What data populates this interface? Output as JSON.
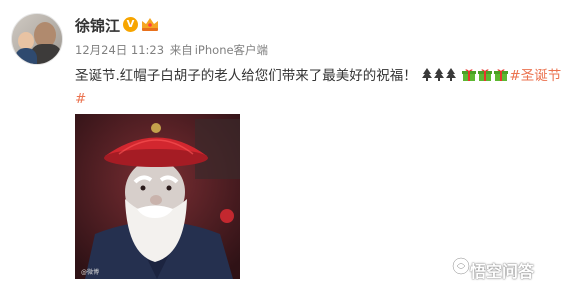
{
  "post": {
    "author": "徐锦江",
    "verified_badge": "V",
    "date": "12月24日 11:23",
    "source_prefix": "来自",
    "source": "iPhone客户端",
    "text": "圣诞节.红帽子白胡子的老人给您们带来了最美好的祝福！",
    "hashtag_part1": "#圣诞节",
    "hashtag_part2": "#",
    "image_caption": "@微博"
  },
  "watermark": {
    "label": "悟空问答"
  },
  "colors": {
    "link": "#eb7350",
    "meta": "#808080",
    "badge": "#f7a500"
  },
  "icons": [
    "verified-icon",
    "vip-crown-icon",
    "christmas-tree-icon",
    "gift-icon",
    "wukong-logo-icon"
  ]
}
